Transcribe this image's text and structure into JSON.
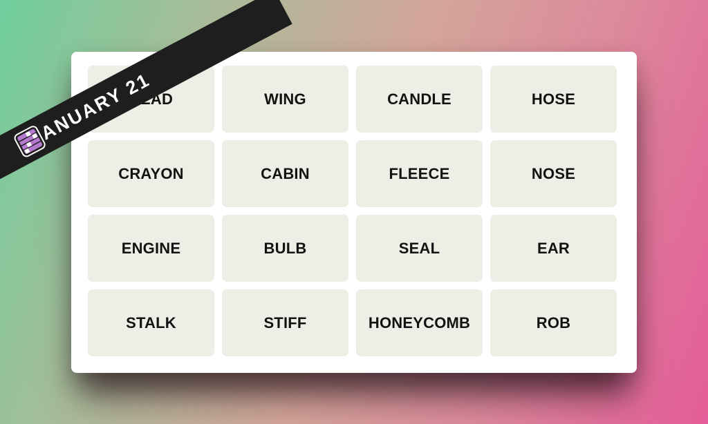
{
  "banner": {
    "date_text": "JANUARY 21",
    "icon": "connections-grid-icon",
    "background_color": "#1e1e1e",
    "icon_color": "#b57ad0"
  },
  "board": {
    "tile_color": "#efeee6",
    "tiles": [
      [
        "HEAD",
        "WING",
        "CANDLE",
        "HOSE"
      ],
      [
        "CRAYON",
        "CABIN",
        "FLEECE",
        "NOSE"
      ],
      [
        "ENGINE",
        "BULB",
        "SEAL",
        "EAR"
      ],
      [
        "STALK",
        "STIFF",
        "HONEYCOMB",
        "ROB"
      ]
    ]
  },
  "background": {
    "gradient_start": "#6fcf9c",
    "gradient_end": "#e45c98"
  }
}
